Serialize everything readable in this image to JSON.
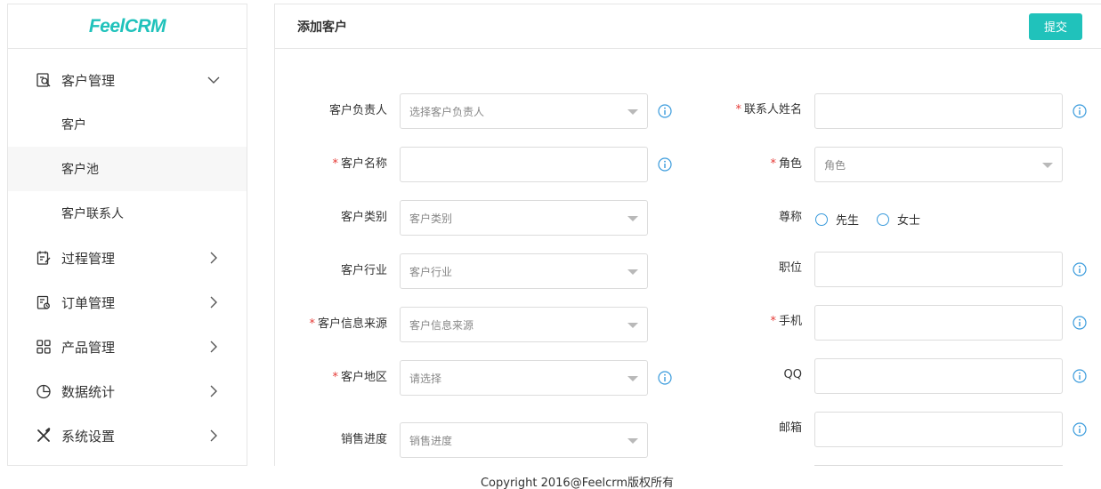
{
  "logo": {
    "text": "FeelCRM"
  },
  "sidebar": {
    "groups": [
      {
        "label": "客户管理",
        "icon": "customer-search-icon",
        "expanded": true,
        "children": [
          {
            "label": "客户"
          },
          {
            "label": "客户池"
          },
          {
            "label": "客户联系人"
          }
        ]
      },
      {
        "label": "过程管理",
        "icon": "clipboard-edit-icon"
      },
      {
        "label": "订单管理",
        "icon": "order-doc-icon"
      },
      {
        "label": "产品管理",
        "icon": "grid-icon"
      },
      {
        "label": "数据统计",
        "icon": "pie-chart-icon"
      },
      {
        "label": "系统设置",
        "icon": "tools-icon"
      }
    ],
    "active_child": "客户池"
  },
  "header": {
    "title": "添加客户",
    "submit_label": "提交"
  },
  "form": {
    "left": [
      {
        "label": "客户负责人",
        "required": false,
        "type": "select",
        "placeholder": "选择客户负责人",
        "info": true
      },
      {
        "label": "客户名称",
        "required": true,
        "type": "input",
        "value": "",
        "info": true
      },
      {
        "label": "客户类别",
        "required": false,
        "type": "select",
        "placeholder": "客户类别",
        "info": false
      },
      {
        "label": "客户行业",
        "required": false,
        "type": "select",
        "placeholder": "客户行业",
        "info": false
      },
      {
        "label": "客户信息来源",
        "required": true,
        "type": "select",
        "placeholder": "客户信息来源",
        "info": false
      },
      {
        "label": "客户地区",
        "required": true,
        "type": "select",
        "placeholder": "请选择",
        "info": true
      },
      {
        "label": "销售进度",
        "required": false,
        "type": "select",
        "placeholder": "销售进度",
        "info": false
      }
    ],
    "right": [
      {
        "label": "联系人姓名",
        "required": true,
        "type": "input",
        "value": "",
        "info": true
      },
      {
        "label": "角色",
        "required": true,
        "type": "select",
        "placeholder": "角色",
        "info": false
      },
      {
        "label": "尊称",
        "required": false,
        "type": "radio",
        "options": [
          "先生",
          "女士"
        ]
      },
      {
        "label": "职位",
        "required": false,
        "type": "input",
        "value": "",
        "info": true
      },
      {
        "label": "手机",
        "required": true,
        "type": "input",
        "value": "",
        "info": true
      },
      {
        "label": "QQ",
        "required": false,
        "type": "input",
        "value": "",
        "info": true
      },
      {
        "label": "邮箱",
        "required": false,
        "type": "input",
        "value": "",
        "info": true
      }
    ]
  },
  "colors": {
    "accent": "#20c2bb",
    "required": "#e53935",
    "info": "#3a9bdc",
    "border": "#dcdcdc"
  },
  "footer": {
    "copyright": "Copyright 2016@Feelcrm版权所有"
  }
}
